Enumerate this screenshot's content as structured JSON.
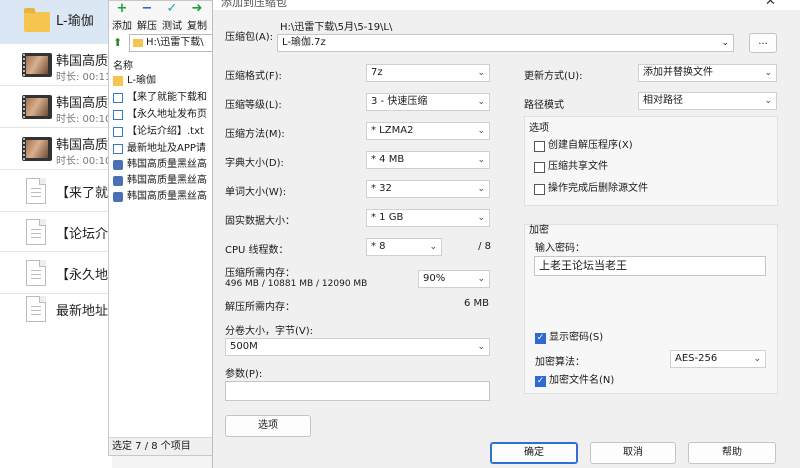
{
  "left_list": {
    "items": [
      {
        "title": "L-瑜伽",
        "kind": "folder",
        "selected": true
      },
      {
        "title": "韩国高质",
        "sub": "时长: 00:11",
        "kind": "video"
      },
      {
        "title": "韩国高质",
        "sub": "时长: 00:10",
        "kind": "video"
      },
      {
        "title": "韩国高质",
        "sub": "时长: 00:10",
        "kind": "video"
      },
      {
        "title": "【来了就能",
        "kind": "doc"
      },
      {
        "title": "【论坛介绍",
        "kind": "doc"
      },
      {
        "title": "【永久地址",
        "kind": "doc"
      },
      {
        "title": "最新地址上",
        "kind": "doc"
      }
    ]
  },
  "archive": {
    "toolbar": [
      {
        "label": "添加",
        "icon": "+",
        "color": "#1e9e3a",
        "name": "add-icon"
      },
      {
        "label": "解压",
        "icon": "−",
        "color": "#2a5fc9",
        "name": "extract-icon"
      },
      {
        "label": "测试",
        "icon": "✓",
        "color": "#1aa7a7",
        "name": "test-icon"
      },
      {
        "label": "复制",
        "icon": "➜",
        "color": "#1e9e3a",
        "name": "copy-icon"
      }
    ],
    "path": "H:\\迅雷下载\\",
    "column": "名称",
    "files": [
      {
        "name": "L-瑜伽",
        "kind": "folder"
      },
      {
        "name": "【来了就能下载和",
        "kind": "txt"
      },
      {
        "name": "【永久地址发布页",
        "kind": "txt"
      },
      {
        "name": "【论坛介绍】.txt",
        "kind": "txt"
      },
      {
        "name": "最新地址及APP请",
        "kind": "txt"
      },
      {
        "name": "韩国高质量黑丝高",
        "kind": "vid"
      },
      {
        "name": "韩国高质量黑丝高",
        "kind": "vid"
      },
      {
        "name": "韩国高质量黑丝高",
        "kind": "vid"
      }
    ],
    "status": "选定 7 / 8 个项目"
  },
  "dialog": {
    "title": "添加到压缩包",
    "close": "✕",
    "archive_label": "压缩包(A):",
    "archive_dir": "H:\\迅雷下载\\5月\\5-19\\L\\",
    "archive_name": "L-瑜伽.7z",
    "browse": "...",
    "format_label": "压缩格式(F):",
    "format": "7z",
    "level_label": "压缩等级(L):",
    "level": "3 - 快速压缩",
    "method_label": "压缩方法(M):",
    "method": "* LZMA2",
    "dict_label": "字典大小(D):",
    "dict": "* 4 MB",
    "word_label": "单词大小(W):",
    "word": "* 32",
    "solid_label": "固实数据大小：",
    "solid": "* 1 GB",
    "cpu_label": "CPU 线程数：",
    "cpu": "* 8",
    "cpu_total": "/ 8",
    "mem_label": "压缩所需内存：",
    "mem_detail": "496 MB / 10881 MB / 12090 MB",
    "mem_pct": "90%",
    "dmem_label": "解压所需内存：",
    "dmem": "6 MB",
    "split_label": "分卷大小，字节(V):",
    "split": "500M",
    "params_label": "参数(P):",
    "params": "",
    "options_btn": "选项",
    "update_label": "更新方式(U):",
    "update": "添加并替换文件",
    "path_label": "路径模式",
    "path_mode": "相对路径",
    "opts_title": "选项",
    "opt_sfx": "创建自解压程序(X)",
    "opt_shared": "压缩共享文件",
    "opt_delete": "操作完成后删除源文件",
    "enc_title": "加密",
    "pw_label": "输入密码：",
    "pw": "上老王论坛当老王",
    "show_pw": "显示密码(S)",
    "enc_method_label": "加密算法：",
    "enc_method": "AES-256",
    "enc_names": "加密文件名(N)",
    "ok": "确定",
    "cancel": "取消",
    "help": "帮助"
  }
}
